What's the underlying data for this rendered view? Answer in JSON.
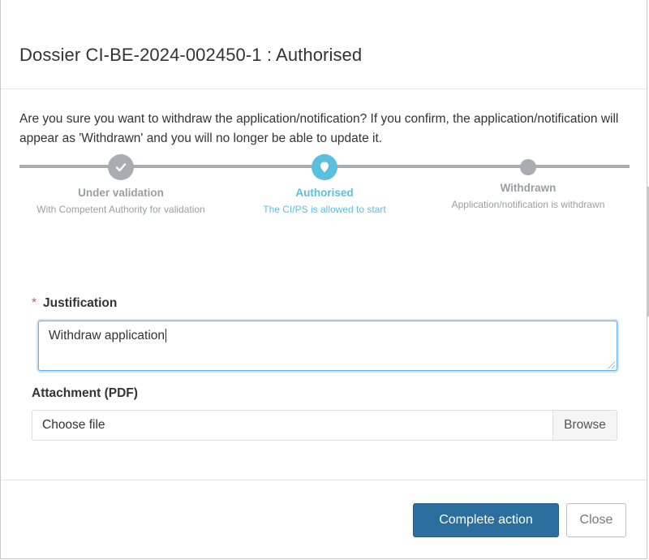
{
  "dialog": {
    "title": "Dossier CI-BE-2024-002450-1 : Authorised",
    "confirm_text": "Are you sure you want to withdraw the application/notification? If you confirm, the application/notification will appear as 'Withdrawn' and you will no longer be able to update it."
  },
  "stepper": {
    "steps": [
      {
        "label": "Under validation",
        "sub": "With Competent Authority for validation",
        "state": "done",
        "icon": "check-icon"
      },
      {
        "label": "Authorised",
        "sub": "The CI/PS is allowed to start",
        "state": "current",
        "icon": "map-marker-icon"
      },
      {
        "label": "Withdrawn",
        "sub": "Application/notification is withdrawn",
        "state": "pending",
        "icon": ""
      }
    ],
    "colors": {
      "done": "#a9adb1",
      "current": "#5bc0de"
    }
  },
  "form": {
    "justification": {
      "label": "Justification",
      "required_marker": "*",
      "value": "Withdraw application"
    },
    "attachment": {
      "label": "Attachment (PDF)",
      "placeholder": "Choose file",
      "browse_label": "Browse"
    }
  },
  "footer": {
    "complete_label": "Complete action",
    "close_label": "Close"
  },
  "colors": {
    "primary": "#2a6f9d",
    "accent": "#5bc0de",
    "required": "#d9534f"
  }
}
